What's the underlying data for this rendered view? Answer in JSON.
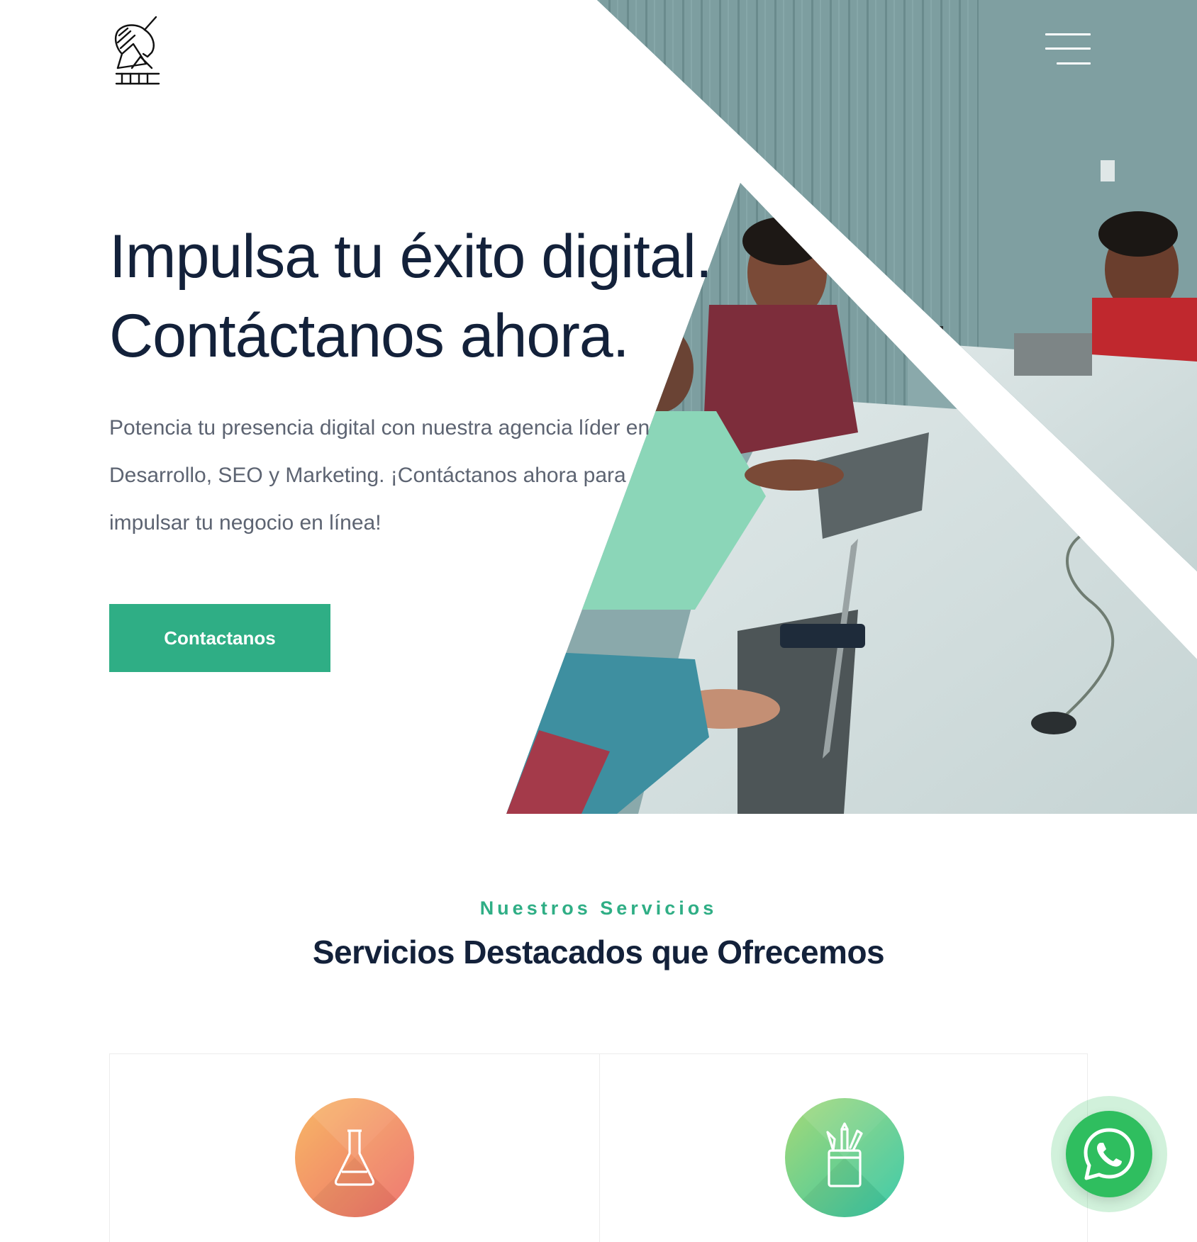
{
  "header": {
    "logo_icon": "unicorn-chess-knight-logo",
    "menu_icon": "hamburger-menu-icon"
  },
  "hero": {
    "title_line1": "Impulsa tu éxito digital.",
    "title_line2": "Contáctanos ahora.",
    "description": "Potencia tu presencia digital con nuestra agencia líder en Desarrollo, SEO y Marketing. ¡Contáctanos ahora para impulsar tu negocio en línea!",
    "cta_label": "Contactanos",
    "image_subject": "team-working-on-laptops-photo"
  },
  "services": {
    "eyebrow": "Nuestros Servicios",
    "title": "Servicios Destacados que Ofrecemos",
    "cards": [
      {
        "icon": "flask-icon",
        "gradient": [
          "#f6b267",
          "#ee6f6a"
        ]
      },
      {
        "icon": "pencil-cup-icon",
        "gradient": [
          "#a7d977",
          "#33c7a6"
        ]
      }
    ]
  },
  "colors": {
    "accent": "#2fae85",
    "heading": "#13213a",
    "body_text": "#5d6472",
    "whatsapp": "#2fbe5f"
  },
  "floating": {
    "whatsapp_icon": "whatsapp-icon"
  }
}
